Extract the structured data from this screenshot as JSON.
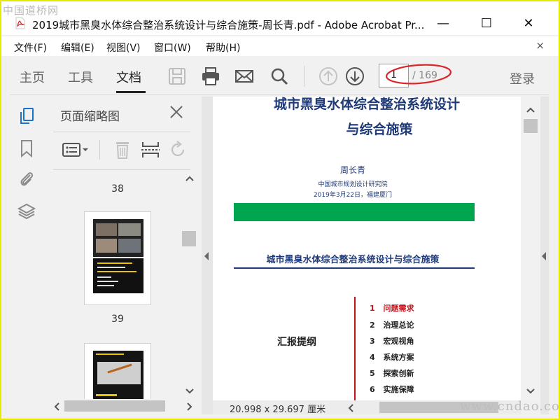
{
  "watermark_top": "中国道桥网",
  "watermark_bottom": "www.cndao.com",
  "window": {
    "title": "2019城市黑臭水体综合整治系统设计与综合施策-周长青.pdf - Adobe Acrobat Pr...",
    "minimize": "—",
    "maximize": "☐",
    "close": "✕"
  },
  "menu": {
    "items": [
      "文件(F)",
      "编辑(E)",
      "视图(V)",
      "窗口(W)",
      "帮助(H)"
    ],
    "close": "×"
  },
  "toolbar": {
    "tabs": [
      "主页",
      "工具",
      "文档"
    ],
    "active_tab": "文档",
    "current_page": "1",
    "total_pages": "/ 169",
    "login": "登录",
    "annotation_color": "#d8262b"
  },
  "thumbnails": {
    "title": "页面缩略图",
    "pages": [
      "38",
      "39"
    ]
  },
  "document": {
    "heading_line1": "城市黑臭水体综合整治系统设计",
    "heading_line2": "与综合施策",
    "author": "周长青",
    "institute": "中国城市规划设计研究院",
    "date_place": "2019年3月22日，福建厦门",
    "green_bar_color": "#00a550",
    "section_title": "城市黑臭水体综合整治系统设计与综合施策",
    "outline_label": "汇报提纲",
    "outline": [
      {
        "num": "1",
        "text": "问题需求",
        "highlight": true
      },
      {
        "num": "2",
        "text": "治理总论",
        "highlight": false
      },
      {
        "num": "3",
        "text": "宏观视角",
        "highlight": false
      },
      {
        "num": "4",
        "text": "系统方案",
        "highlight": false
      },
      {
        "num": "5",
        "text": "探索创新",
        "highlight": false
      },
      {
        "num": "6",
        "text": "实施保障",
        "highlight": false
      }
    ]
  },
  "status": {
    "page_size": "20.998 x 29.697 厘米"
  }
}
